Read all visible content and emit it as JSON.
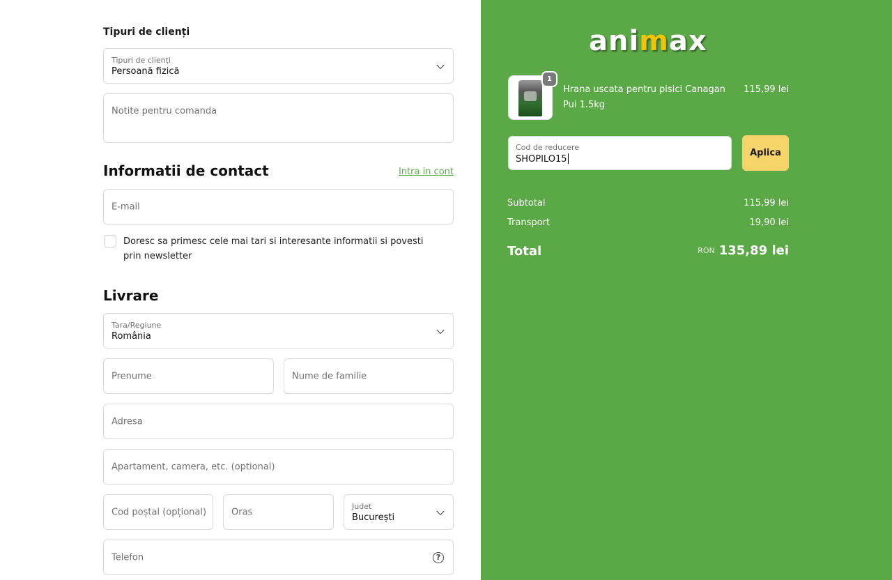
{
  "customer_type": {
    "section_label": "Tipuri de clienți",
    "select_label": "Tipuri de clienți",
    "select_value": "Persoană fizică"
  },
  "notes": {
    "placeholder": "Notite pentru comanda"
  },
  "contact": {
    "title": "Informatii de contact",
    "login_link": "Intra in cont",
    "email_placeholder": "E-mail",
    "newsletter_text": "Doresc sa primesc cele mai tari si interesante informatii si povesti prin newsletter"
  },
  "delivery": {
    "title": "Livrare",
    "country_label": "Tara/Regiune",
    "country_value": "România",
    "first_name_placeholder": "Prenume",
    "last_name_placeholder": "Nume de familie",
    "address_placeholder": "Adresa",
    "apartment_placeholder": "Apartament, camera, etc. (optional)",
    "postal_placeholder": "Cod poștal (opțional)",
    "city_placeholder": "Oras",
    "county_label": "Judet",
    "county_value": "București",
    "phone_placeholder": "Telefon"
  },
  "summary": {
    "logo_text_a": "ani",
    "logo_text_m": "m",
    "logo_text_b": "ax",
    "product": {
      "name": "Hrana uscata pentru pisici Canagan Pui 1.5kg",
      "price": "115,99 lei",
      "quantity": "1"
    },
    "discount": {
      "label": "Cod de reducere",
      "value": "SHOPILO15",
      "apply_label": "Aplica"
    },
    "subtotal_label": "Subtotal",
    "subtotal_value": "115,99 lei",
    "shipping_label": "Transport",
    "shipping_value": "19,90 lei",
    "total_label": "Total",
    "total_currency": "RON",
    "total_value": "135,89 lei"
  },
  "colors": {
    "accent_green": "#5ba946",
    "apply_yellow": "#f7d46a",
    "logo_yellow": "#f4c400"
  }
}
